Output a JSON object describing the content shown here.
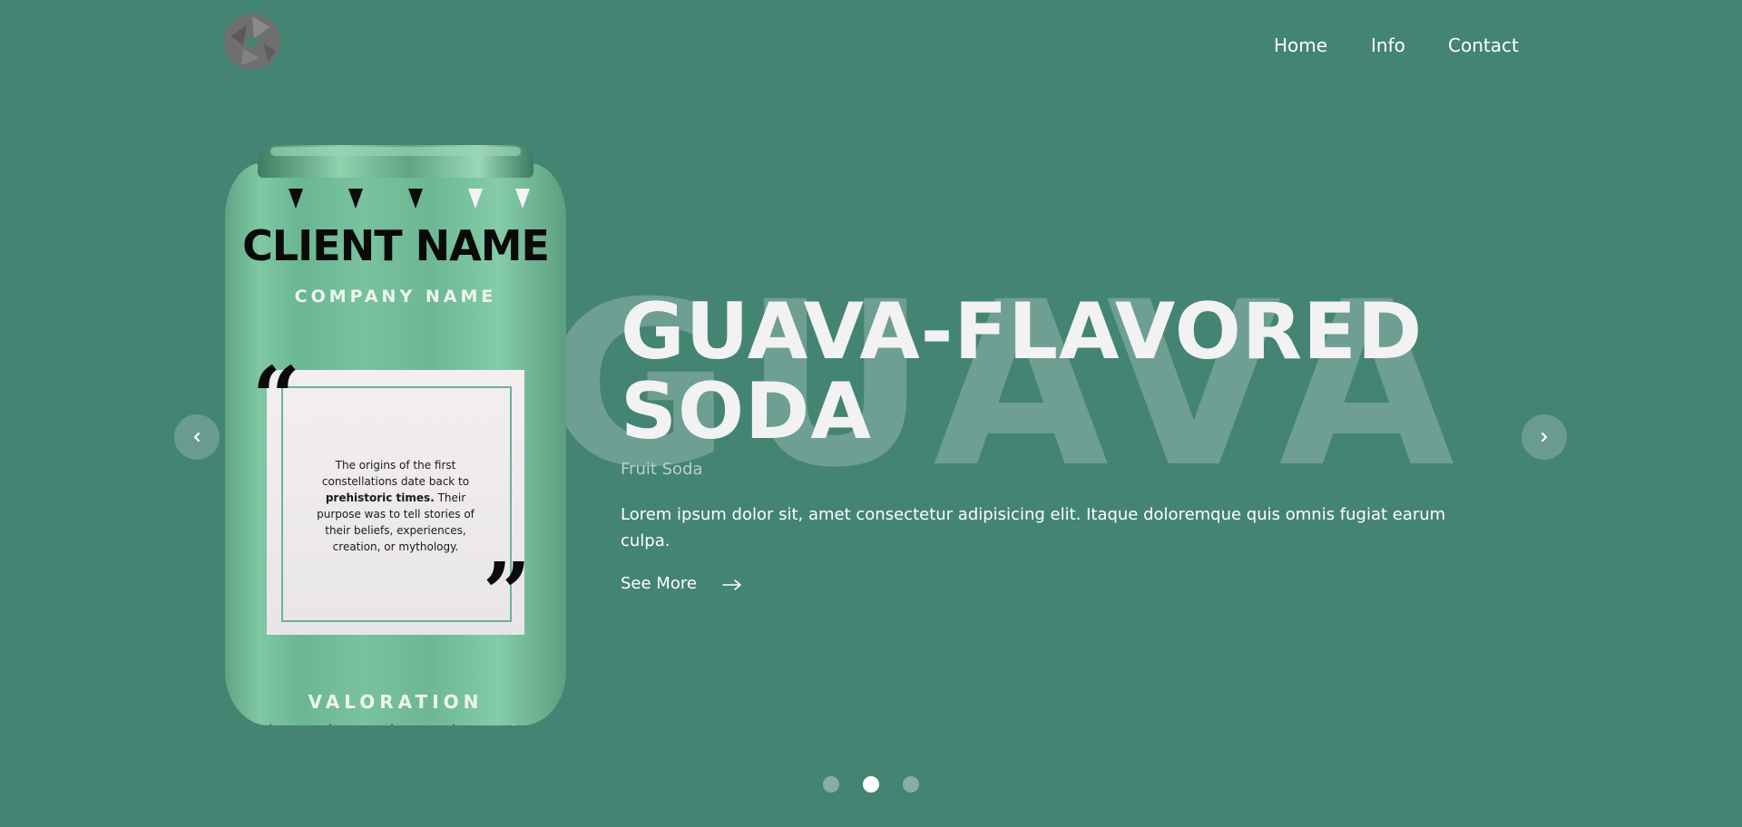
{
  "nav": {
    "items": [
      "Home",
      "Info",
      "Contact"
    ]
  },
  "background_word": "GUAVA",
  "can": {
    "client_name": "CLIENT NAME",
    "company_name": "COMPANY NAME",
    "quote_text_before": "The origins of the first constellations date back to ",
    "quote_text_bold": "prehistoric times.",
    "quote_text_after": " Their purpose was to tell stories of their beliefs, experiences, creation, or mythology.",
    "quote_open": "“",
    "quote_close": "”",
    "bottom_label": "VALORATION"
  },
  "hero": {
    "title": "GUAVA-FLAVORED SODA",
    "subtitle": "Fruit Soda",
    "description": "Lorem ipsum dolor sit, amet consectetur adipisicing elit. Itaque doloremque quis omnis fugiat earum culpa.",
    "cta_label": "See More"
  },
  "carousel": {
    "slides": 3,
    "active_index": 1
  },
  "colors": {
    "background": "#448472",
    "can": "#79c29e",
    "background_word": "#6e9f92"
  },
  "icons": {
    "logo": "logo-icon",
    "prev": "chevron-left-icon",
    "next": "chevron-right-icon",
    "cta": "arrow-right-icon"
  }
}
